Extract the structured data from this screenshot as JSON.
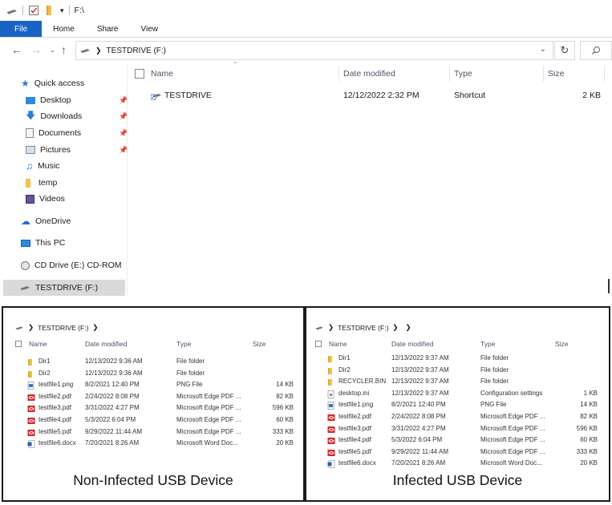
{
  "window": {
    "path_title": "F:\\",
    "tabs": [
      {
        "label": "File"
      },
      {
        "label": "Home"
      },
      {
        "label": "Share"
      },
      {
        "label": "View"
      }
    ],
    "address": "TESTDRIVE (F:)"
  },
  "nav": {
    "items": [
      {
        "label": "Quick access",
        "icon": "star-icon"
      },
      {
        "label": "Desktop",
        "icon": "desktop-folder-icon"
      },
      {
        "label": "Downloads",
        "icon": "download-arrow-icon"
      },
      {
        "label": "Documents",
        "icon": "documents-icon"
      },
      {
        "label": "Pictures",
        "icon": "pictures-icon"
      },
      {
        "label": "Music",
        "icon": "music-note-icon"
      },
      {
        "label": "temp",
        "icon": "folder-icon"
      },
      {
        "label": "Videos",
        "icon": "videos-icon"
      },
      {
        "label": "OneDrive",
        "icon": "cloud-icon"
      },
      {
        "label": "This PC",
        "icon": "computer-icon"
      },
      {
        "label": "CD Drive (E:) CD-ROM",
        "icon": "cd-drive-icon"
      },
      {
        "label": "TESTDRIVE (F:)",
        "icon": "usb-drive-icon"
      }
    ]
  },
  "columns": {
    "name": "Name",
    "date": "Date modified",
    "type": "Type",
    "size": "Size"
  },
  "files": [
    {
      "name": "TESTDRIVE",
      "date": "12/12/2022 2:32 PM",
      "type": "Shortcut",
      "size": "2 KB",
      "icon": "shortcut-icon"
    }
  ],
  "left_panel": {
    "address": "TESTDRIVE (F:)",
    "columns": {
      "name": "Name",
      "date": "Date modified",
      "type": "Type",
      "size": "Size"
    },
    "rows": [
      {
        "name": "Dir1",
        "date": "12/13/2022 9:36 AM",
        "type": "File folder",
        "size": "",
        "icon": "folder-icon"
      },
      {
        "name": "Dir2",
        "date": "12/13/2022 9:36 AM",
        "type": "File folder",
        "size": "",
        "icon": "folder-icon"
      },
      {
        "name": "testfile1.png",
        "date": "8/2/2021 12:40 PM",
        "type": "PNG File",
        "size": "14 KB",
        "icon": "image-file-icon"
      },
      {
        "name": "testfile2.pdf",
        "date": "2/24/2022 8:08 PM",
        "type": "Microsoft Edge PDF ...",
        "size": "82 KB",
        "icon": "pdf-icon"
      },
      {
        "name": "testfile3.pdf",
        "date": "3/31/2022 4:27 PM",
        "type": "Microsoft Edge PDF ...",
        "size": "596 KB",
        "icon": "pdf-icon"
      },
      {
        "name": "testfile4.pdf",
        "date": "5/3/2022 6:04 PM",
        "type": "Microsoft Edge PDF ...",
        "size": "60 KB",
        "icon": "pdf-icon"
      },
      {
        "name": "testfile5.pdf",
        "date": "9/29/2022 11:44 AM",
        "type": "Microsoft Edge PDF ...",
        "size": "333 KB",
        "icon": "pdf-icon"
      },
      {
        "name": "testfile6.docx",
        "date": "7/20/2021 8:26 AM",
        "type": "Microsoft Word Doc...",
        "size": "20 KB",
        "icon": "word-doc-icon"
      }
    ],
    "caption": "Non-Infected USB Device"
  },
  "right_panel": {
    "address": "TESTDRIVE (F:)",
    "columns": {
      "name": "Name",
      "date": "Date modified",
      "type": "Type",
      "size": "Size"
    },
    "rows": [
      {
        "name": "Dir1",
        "date": "12/13/2022 9:37 AM",
        "type": "File folder",
        "size": "",
        "icon": "folder-icon"
      },
      {
        "name": "Dir2",
        "date": "12/13/2022 9:37 AM",
        "type": "File folder",
        "size": "",
        "icon": "folder-icon"
      },
      {
        "name": "RECYCLER.BIN",
        "date": "12/13/2022 9:37 AM",
        "type": "File folder",
        "size": "",
        "icon": "folder-icon"
      },
      {
        "name": "desktop.ini",
        "date": "12/13/2022 9:37 AM",
        "type": "Configuration settings",
        "size": "1 KB",
        "icon": "settings-file-icon"
      },
      {
        "name": "testfile1.png",
        "date": "8/2/2021 12:40 PM",
        "type": "PNG File",
        "size": "14 KB",
        "icon": "image-file-icon"
      },
      {
        "name": "testfile2.pdf",
        "date": "2/24/2022 8:08 PM",
        "type": "Microsoft Edge PDF ...",
        "size": "82 KB",
        "icon": "pdf-icon"
      },
      {
        "name": "testfile3.pdf",
        "date": "3/31/2022 4:27 PM",
        "type": "Microsoft Edge PDF ...",
        "size": "596 KB",
        "icon": "pdf-icon"
      },
      {
        "name": "testfile4.pdf",
        "date": "5/3/2022 6:04 PM",
        "type": "Microsoft Edge PDF ...",
        "size": "60 KB",
        "icon": "pdf-icon"
      },
      {
        "name": "testfile5.pdf",
        "date": "9/29/2022 11:44 AM",
        "type": "Microsoft Edge PDF ...",
        "size": "333 KB",
        "icon": "pdf-icon"
      },
      {
        "name": "testfile6.docx",
        "date": "7/20/2021 8:26 AM",
        "type": "Microsoft Word Doc...",
        "size": "20 KB",
        "icon": "word-doc-icon"
      }
    ],
    "caption": "Infected USB Device"
  },
  "colors": {
    "file_tab": "#1a63c6",
    "selection": "#d9d9d9",
    "folder": "#f2c04b",
    "pdf": "#d9262c",
    "word": "#2b5fb8"
  }
}
